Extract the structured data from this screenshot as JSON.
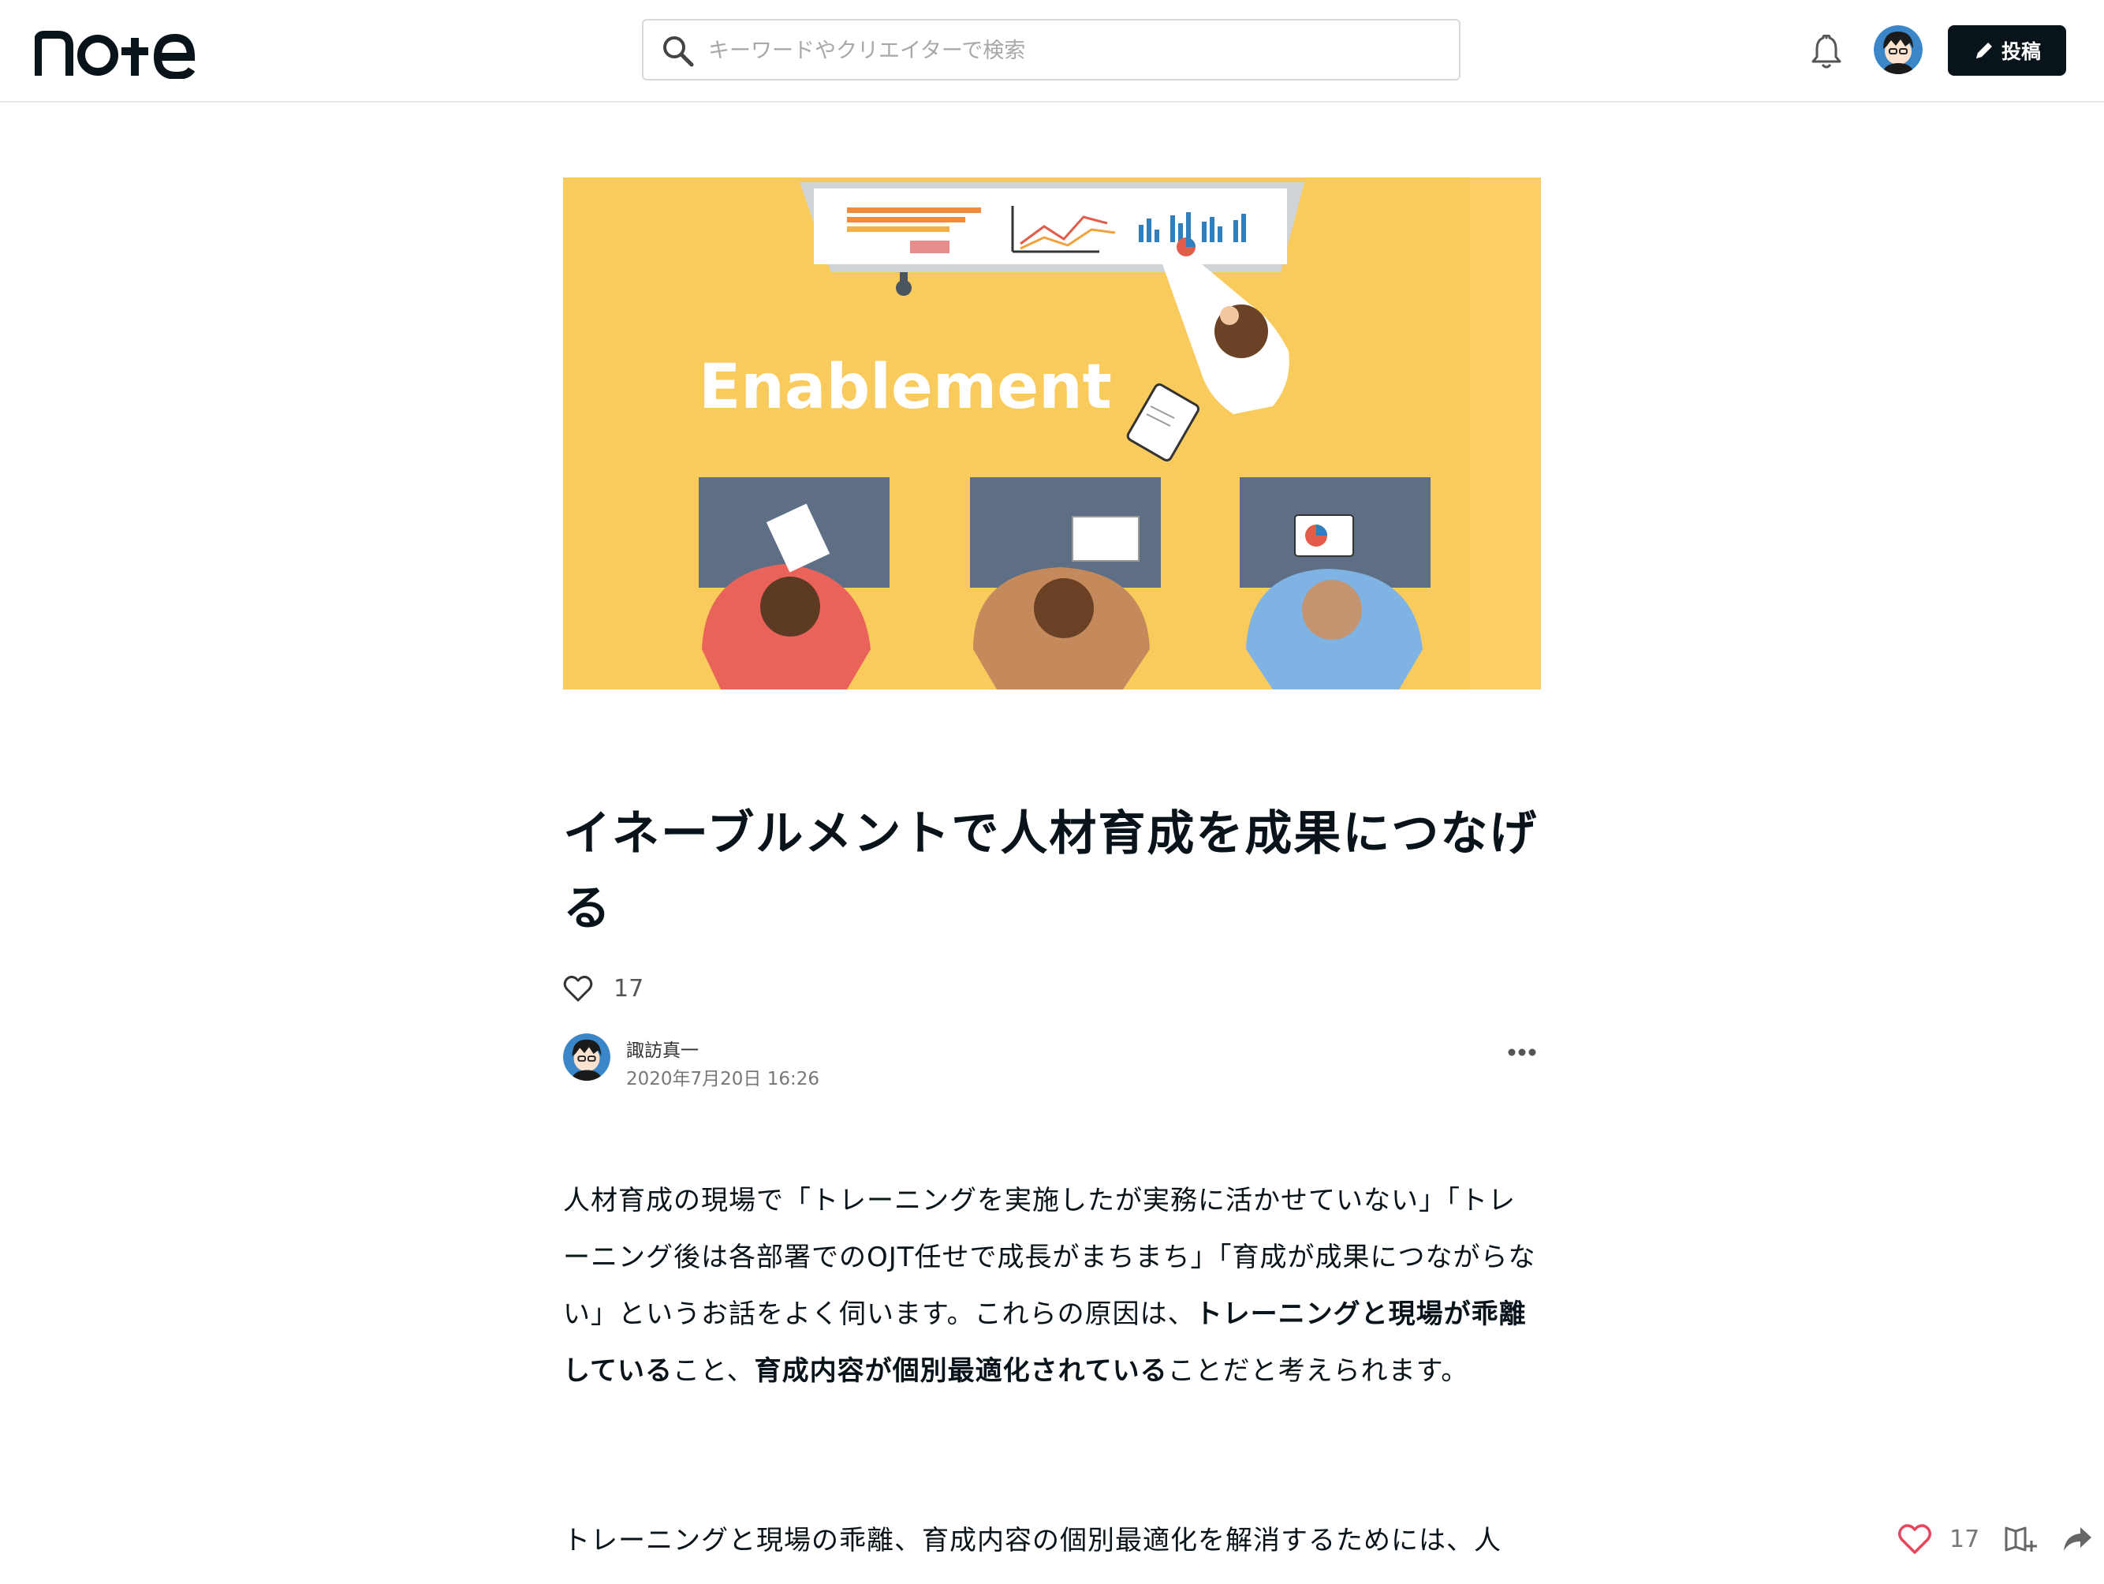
{
  "header": {
    "logo_text": "note",
    "search_placeholder": "キーワードやクリエイターで検索",
    "post_button_label": "投稿"
  },
  "hero": {
    "heading": "Enablement"
  },
  "article": {
    "title": "イネーブルメントで人材育成を成果につなげる",
    "like_count": "17",
    "author_name": "諏訪真一",
    "published_at": "2020年7月20日 16:26",
    "paragraph1": {
      "t1": "人材育成の現場で「トレーニングを実施したが実務に活かせていない」「トレーニング後は各部署でのOJT任せで成長がまちまち」「育成が成果につながらない」というお話をよく伺います。これらの原因は、",
      "b1": "トレーニングと現場が乖離している",
      "t2": "こと、",
      "b2": "育成内容が個別最適化されている",
      "t3": "ことだと考えられます。"
    },
    "paragraph2": "トレーニングと現場の乖離、育成内容の個別最適化を解消するためには、人"
  },
  "floating_actions": {
    "like_count": "17"
  },
  "colors": {
    "brand_dark": "#08131a",
    "hero_bg": "#f9cb5d",
    "like_red": "#e5475d"
  },
  "icons": [
    "search-icon",
    "bell-icon",
    "pencil-icon",
    "heart-icon",
    "more-icon",
    "magazine-add-icon",
    "share-icon"
  ]
}
